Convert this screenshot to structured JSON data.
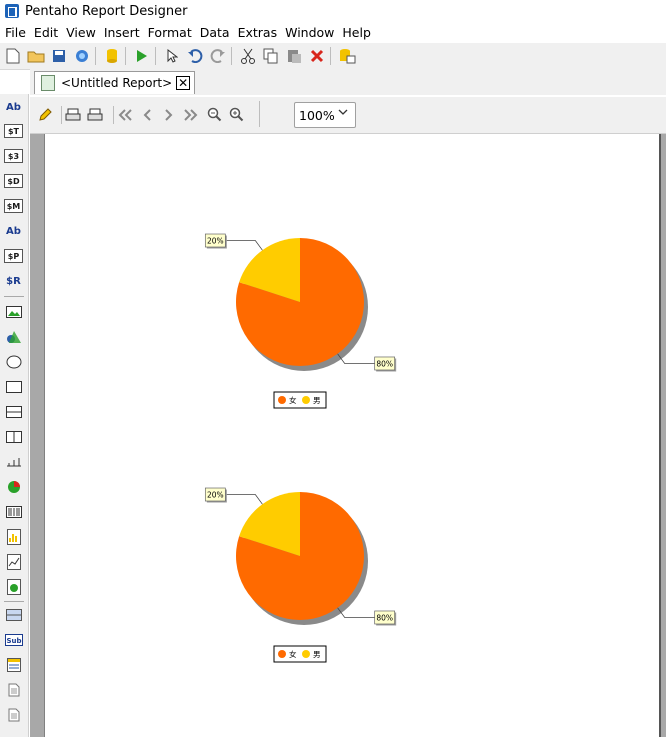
{
  "app": {
    "title": "Pentaho Report Designer"
  },
  "menu": [
    "File",
    "Edit",
    "View",
    "Insert",
    "Format",
    "Data",
    "Extras",
    "Window",
    "Help"
  ],
  "tab": {
    "label": "<Untitled Report>"
  },
  "zoom": {
    "value": "100%"
  },
  "left_tools": [
    "Ab",
    "$T",
    "$3",
    "$D",
    "$M",
    "Ab",
    "$P",
    "$R"
  ],
  "colors": {
    "female": "#ff6a00",
    "male": "#ffcc00",
    "shadow": "#8a8a8a",
    "label_bg": "#ffffcc"
  },
  "chart_data": [
    {
      "type": "pie",
      "categories": [
        "女",
        "男"
      ],
      "values": [
        80,
        20
      ],
      "data_labels": [
        "80%",
        "20%"
      ],
      "legend": [
        "女",
        "男"
      ],
      "legend_position": "bottom"
    },
    {
      "type": "pie",
      "categories": [
        "女",
        "男"
      ],
      "values": [
        80,
        20
      ],
      "data_labels": [
        "80%",
        "20%"
      ],
      "legend": [
        "女",
        "男"
      ],
      "legend_position": "bottom"
    }
  ]
}
